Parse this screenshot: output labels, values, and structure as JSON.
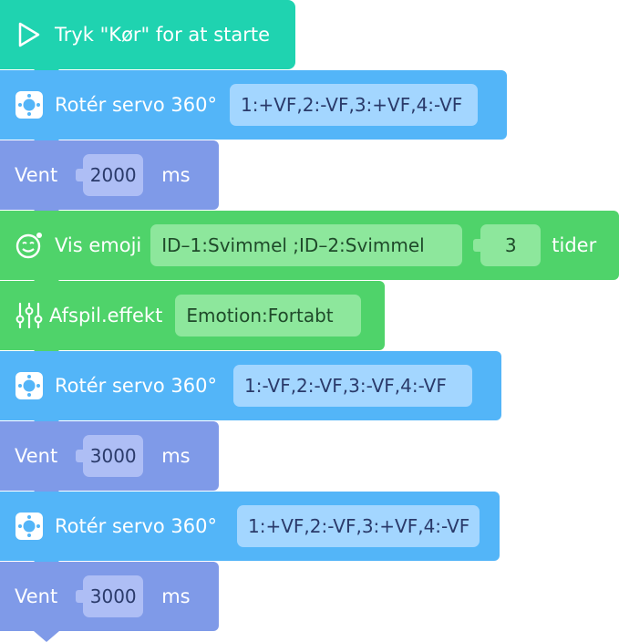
{
  "start": {
    "label": "Tryk \"Kør\" for at starte",
    "icon": "play-icon"
  },
  "blocks": [
    {
      "type": "servo",
      "label": "Rotér servo 360°",
      "value": "1:+VF,2:-VF,3:+VF,4:-VF",
      "icon": "servo-icon"
    },
    {
      "type": "wait",
      "label": "Vent",
      "value": "2000",
      "unit": "ms"
    },
    {
      "type": "emoji",
      "label": "Vis emoji",
      "value": "ID–1:Svimmel ;ID–2:Svimmel",
      "count": "3",
      "unit": "tider",
      "icon": "emoji-face-icon"
    },
    {
      "type": "effect",
      "label": "Afspil.effekt",
      "value": "Emotion:Fortabt",
      "icon": "equalizer-icon"
    },
    {
      "type": "servo",
      "label": "Rotér servo 360°",
      "value": "1:-VF,2:-VF,3:-VF,4:-VF",
      "icon": "servo-icon"
    },
    {
      "type": "wait",
      "label": "Vent",
      "value": "3000",
      "unit": "ms"
    },
    {
      "type": "servo",
      "label": "Rotér servo 360°",
      "value": "1:+VF,2:-VF,3:+VF,4:-VF",
      "icon": "servo-icon"
    },
    {
      "type": "wait",
      "label": "Vent",
      "value": "3000",
      "unit": "ms"
    }
  ],
  "colors": {
    "start": "#1fd3b0",
    "servo": "#53b5f8",
    "wait": "#7f9ae8",
    "green": "#4fd36a"
  }
}
